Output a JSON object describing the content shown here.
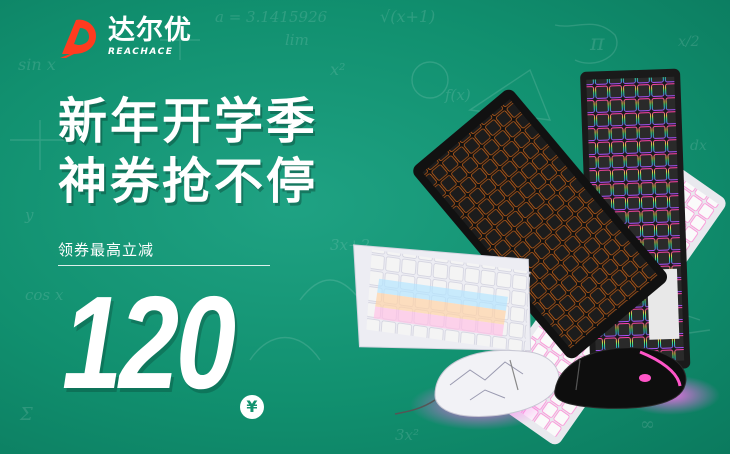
{
  "brand": {
    "name_cn": "达尔优",
    "name_en": "REACHACE"
  },
  "headline": {
    "line1": "新年开学季",
    "line2": "神券抢不停"
  },
  "coupon": {
    "label": "领券最高立减",
    "amount": "120",
    "currency": "¥"
  },
  "doodles": [
    "a = 3.1415926",
    "sin x",
    "√(x+1)",
    "π",
    "f(x)",
    "x²",
    "lim",
    "cos x",
    "3x+2",
    "dx",
    "Σ",
    "∞",
    "x/2",
    "3x²",
    "y"
  ],
  "colors": {
    "background": "#13936f",
    "text": "#ffffff",
    "accent": "#ff3b1f"
  }
}
